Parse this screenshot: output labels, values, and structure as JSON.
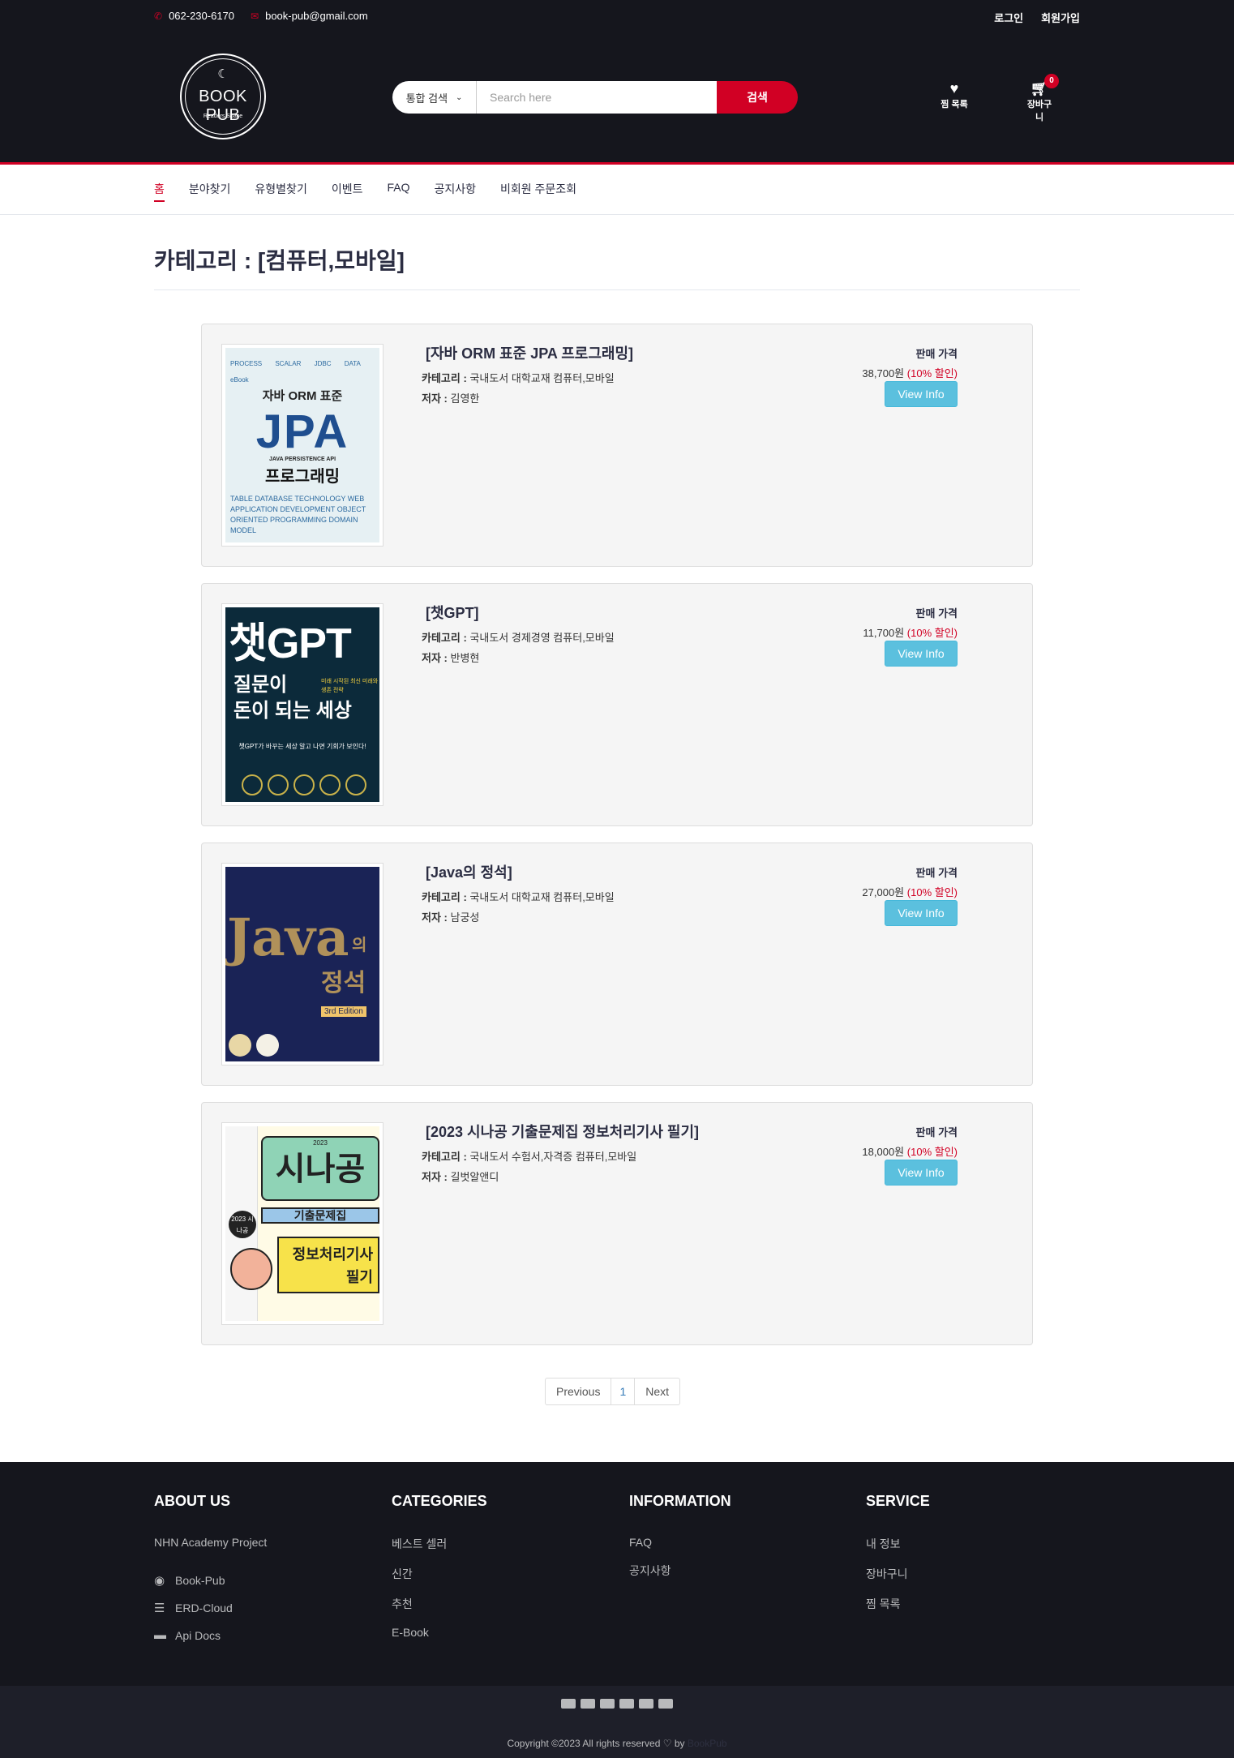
{
  "topbar": {
    "phone": "062-230-6170",
    "email": "book-pub@gmail.com",
    "login": "로그인",
    "signup": "회원가입"
  },
  "logo": {
    "name": "BOOK PUB",
    "tagline": "Readers Space"
  },
  "search": {
    "category_selected": "통합 검색",
    "placeholder": "Search here",
    "button": "검색"
  },
  "header_links": {
    "wishlist": "찜 목록",
    "cart": "장바구니",
    "cart_count": "0"
  },
  "nav": {
    "items": [
      "홈",
      "분야찾기",
      "유형별찾기",
      "이벤트",
      "FAQ",
      "공지사항",
      "비회원 주문조회"
    ],
    "active_index": 0
  },
  "page": {
    "title": "카테고리 : [컴퓨터,모바일]"
  },
  "books": [
    {
      "title": "[자바 ORM 표준 JPA 프로그래밍]",
      "category_label": "카테고리 :",
      "category": "국내도서 대학교재 컴퓨터,모바일",
      "author_label": "저자 :",
      "author": "김영한",
      "price_label": "판매 가격",
      "price": "38,700원",
      "discount": "(10% 할인)",
      "button": "View Info",
      "cover": {
        "top_words": "PROCESS SCALAR JDBC DATA eBook",
        "heading": "자바 ORM 표준",
        "big": "JPA",
        "sub": "JAVA PERSISTENCE API",
        "kor": "프로그래밍",
        "bottom_words": "TABLE DATABASE TECHNOLOGY WEB APPLICATION DEVELOPMENT OBJECT ORIENTED PROGRAMMING DOMAIN MODEL"
      }
    },
    {
      "title": "[챗GPT]",
      "category_label": "카테고리 :",
      "category": "국내도서 경제경영 컴퓨터,모바일",
      "author_label": "저자 :",
      "author": "반병현",
      "price_label": "판매 가격",
      "price": "11,700원",
      "discount": "(10% 할인)",
      "button": "View Info",
      "cover": {
        "h1": "챗GPT",
        "h2a": "질문이",
        "h2b": "돈이 되는 세상",
        "side": "미래 시작된 최신 미래와 생존 전략",
        "bottom": "챗GPT가 바꾸는 세상 알고 나면 기회가 보인다!"
      }
    },
    {
      "title": "[Java의 정석]",
      "category_label": "카테고리 :",
      "category": "국내도서 대학교재 컴퓨터,모바일",
      "author_label": "저자 :",
      "author": "남궁성",
      "price_label": "판매 가격",
      "price": "27,000원",
      "discount": "(10% 할인)",
      "button": "View Info",
      "cover": {
        "big": "Java",
        "ui": "의",
        "js": "정석",
        "edition": "3rd Edition"
      }
    },
    {
      "title": "[2023 시나공 기출문제집 정보처리기사 필기]",
      "category_label": "카테고리 :",
      "category": "국내도서 수험서,자격증 컴퓨터,모바일",
      "author_label": "저자 :",
      "author": "길벗알앤디",
      "price_label": "판매 가격",
      "price": "18,000원",
      "discount": "(10% 할인)",
      "button": "View Info",
      "cover": {
        "year": "2023",
        "name": "시나공",
        "band": "기출문제집",
        "yellow1": "정보처리기사",
        "yellow2": "필기",
        "badge": "2023 시나공"
      }
    }
  ],
  "pagination": {
    "prev": "Previous",
    "page": "1",
    "next": "Next"
  },
  "footer": {
    "about": {
      "heading": "About Us",
      "text": "NHN Academy Project",
      "links": [
        "Book-Pub",
        "ERD-Cloud",
        "Api Docs"
      ]
    },
    "categories": {
      "heading": "Categories",
      "links": [
        "베스트 셀러",
        "신간",
        "추천",
        "E-Book"
      ]
    },
    "information": {
      "heading": "Information",
      "links": [
        "FAQ",
        "공지사항"
      ]
    },
    "service": {
      "heading": "Service",
      "links": [
        "내 정보",
        "장바구니",
        "찜 목록"
      ]
    },
    "copyright": "Copyright ©2023 All rights reserved ♡ by",
    "brand": "BookPub"
  },
  "icons": {
    "phone": "phone-icon",
    "email": "envelope-icon",
    "wishlist": "heart-icon",
    "cart": "shopping-cart-icon",
    "github": "github-icon",
    "erd": "database-icon",
    "docs": "book-icon"
  },
  "colors": {
    "accent": "#d10024",
    "header_bg": "#15161d",
    "info_button": "#5bc0de"
  }
}
